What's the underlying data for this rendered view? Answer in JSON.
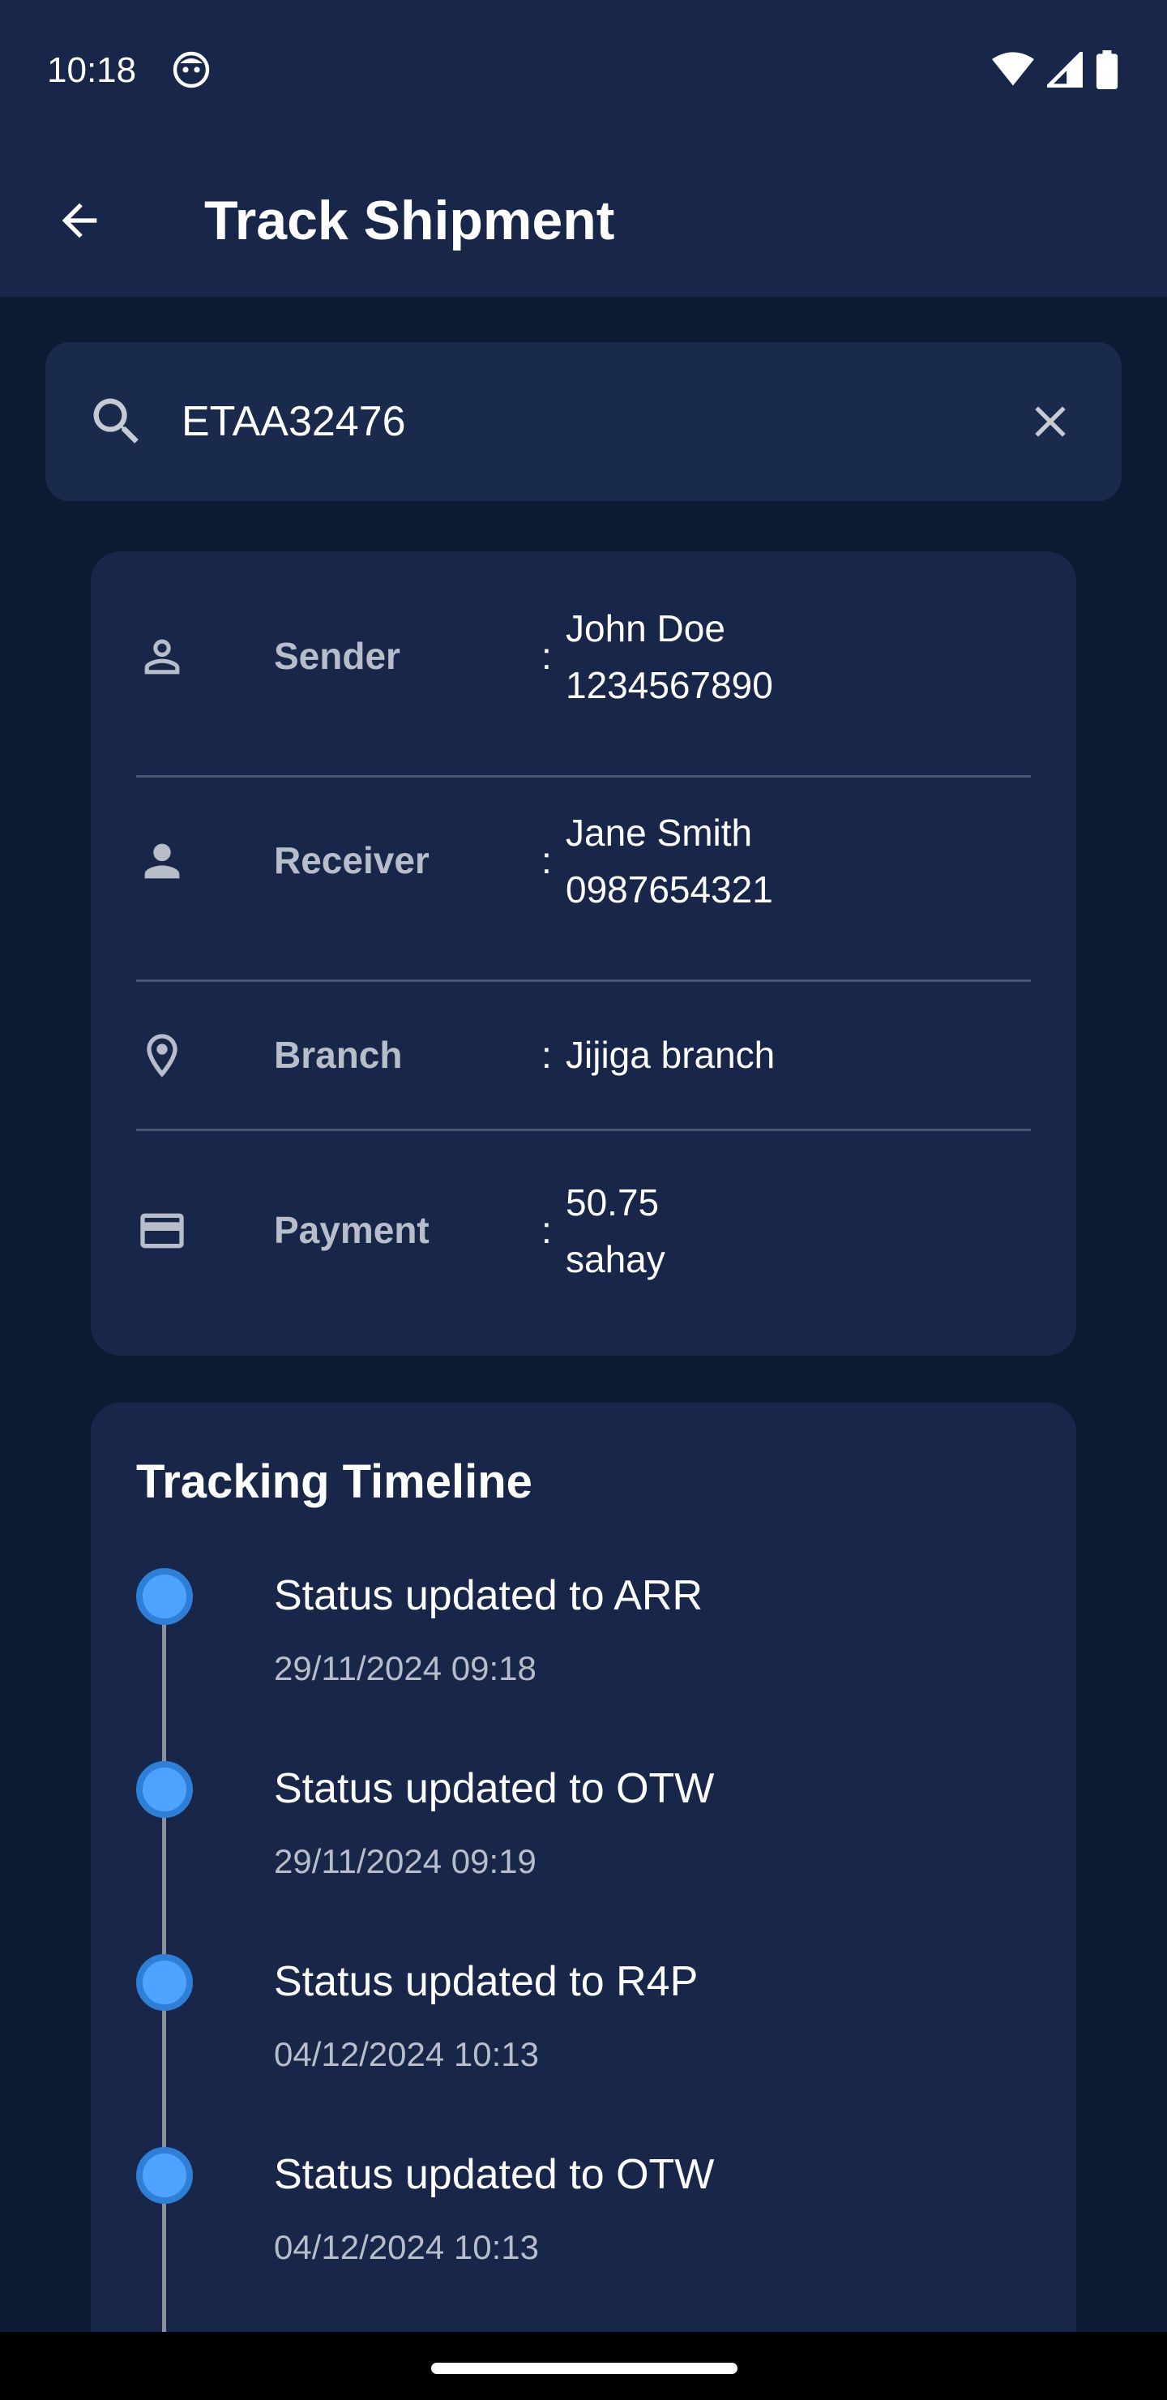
{
  "status_bar": {
    "time": "10:18"
  },
  "app_bar": {
    "title": "Track Shipment"
  },
  "search": {
    "value": "ETAA32476"
  },
  "details": [
    {
      "icon": "person-outline-icon",
      "label": "Sender",
      "line1": "John Doe",
      "line2": "1234567890"
    },
    {
      "icon": "person-filled-icon",
      "label": "Receiver",
      "line1": "Jane Smith",
      "line2": "0987654321"
    },
    {
      "icon": "location-pin-icon",
      "label": "Branch",
      "line1": "Jijiga branch",
      "line2": ""
    },
    {
      "icon": "credit-card-icon",
      "label": "Payment",
      "line1": "50.75",
      "line2": "sahay"
    }
  ],
  "timeline": {
    "title": "Tracking Timeline",
    "items": [
      {
        "status": "Status updated to ARR",
        "time": "29/11/2024 09:18"
      },
      {
        "status": "Status updated to OTW",
        "time": "29/11/2024 09:19"
      },
      {
        "status": "Status updated to R4P",
        "time": "04/12/2024 10:13"
      },
      {
        "status": "Status updated to OTW",
        "time": "04/12/2024 10:13"
      }
    ]
  },
  "colors": {
    "background": "#0c1a33",
    "surface": "#18264a",
    "accent": "#4da3ff"
  }
}
